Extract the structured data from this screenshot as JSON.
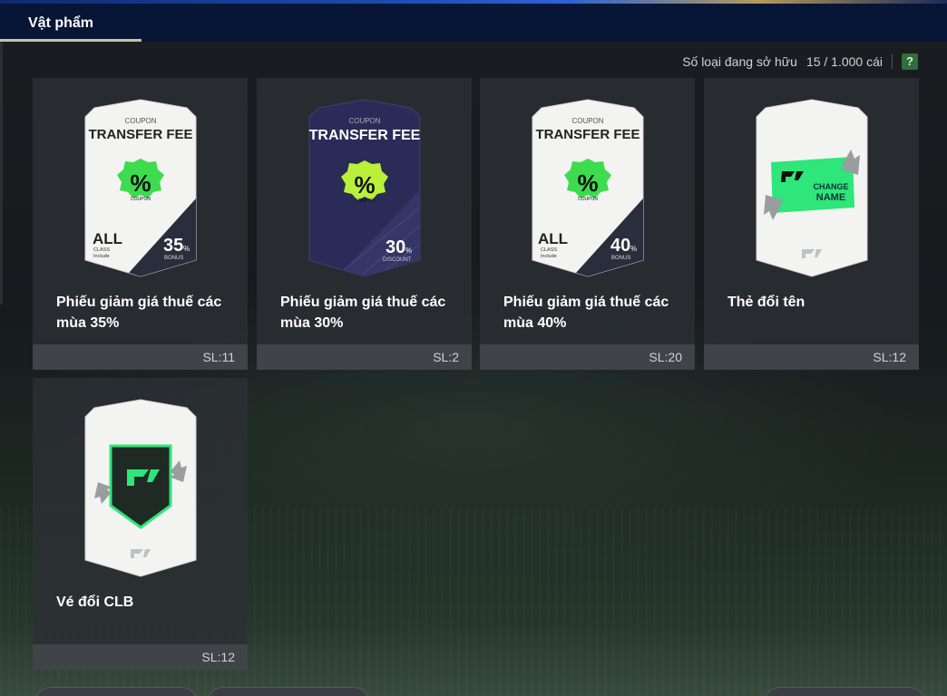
{
  "tabs": [
    {
      "label": "Vật phẩm",
      "active": true
    }
  ],
  "owned": {
    "label": "Số loại đang sở hữu",
    "count": "15 / 1.000 cái",
    "help_icon": "?"
  },
  "items": [
    {
      "name": "Phiếu giảm giá thuế các mùa 35%",
      "qty": "SL:11",
      "art": {
        "kind": "coupon",
        "theme": "white",
        "caption": "COUPON",
        "title": "TRANSFER FEE",
        "badge": "%",
        "badge_sub": "COUPON",
        "left_big": "ALL",
        "left_small1": "CLASS",
        "left_small2": "Include",
        "pct": "35",
        "pct_unit": "%",
        "pct_sub": "BONUS"
      }
    },
    {
      "name": "Phiếu giảm giá thuế các mùa 30%",
      "qty": "SL:2",
      "art": {
        "kind": "coupon",
        "theme": "purple",
        "caption": "COUPON",
        "title": "TRANSFER FEE",
        "badge": "%",
        "badge_sub": "COUPON",
        "pct": "30",
        "pct_unit": "%",
        "pct_sub": "DISCOUNT"
      }
    },
    {
      "name": "Phiếu giảm giá thuế các mùa 40%",
      "qty": "SL:20",
      "art": {
        "kind": "coupon",
        "theme": "white",
        "caption": "COUPON",
        "title": "TRANSFER FEE",
        "badge": "%",
        "badge_sub": "COUPON",
        "left_big": "ALL",
        "left_small1": "CLASS",
        "left_small2": "Include",
        "pct": "40",
        "pct_unit": "%",
        "pct_sub": "BONUS"
      }
    },
    {
      "name": "Thẻ đổi tên",
      "qty": "SL:12",
      "art": {
        "kind": "change-name",
        "label1": "CHANGE",
        "label2": "NAME"
      }
    },
    {
      "name": "Vé đổi CLB",
      "qty": "SL:12",
      "art": {
        "kind": "change-club"
      }
    }
  ],
  "colors": {
    "header": "#071536",
    "tab_underline": "#c8c3a5",
    "accent_green": "#2ee67a",
    "badge_green": "#3ddc4f",
    "coupon_purple": "#2b2b57",
    "help_green": "#2f6f3a"
  }
}
